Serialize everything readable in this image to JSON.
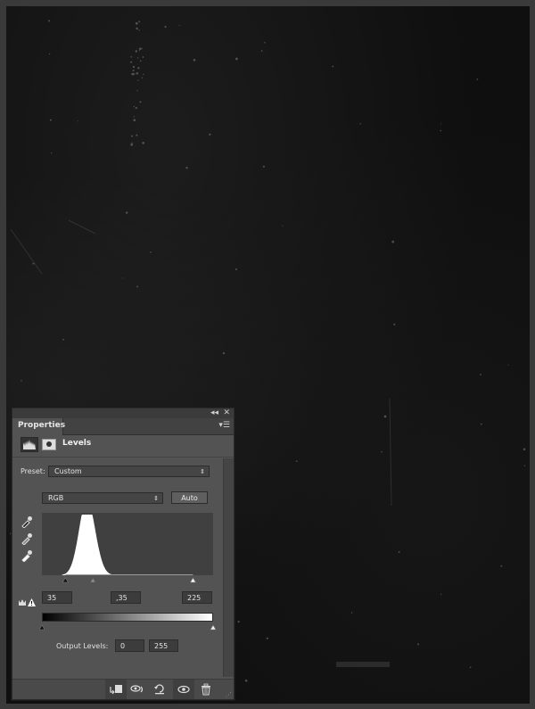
{
  "panel": {
    "tab_label": "Properties",
    "collapse_icon": "double-chevron-left-icon",
    "close_icon": "close-icon",
    "menu_icon": "panel-menu-icon",
    "adjustment_name": "Levels",
    "preset_label": "Preset:",
    "preset_value": "Custom",
    "channel_value": "RGB",
    "auto_label": "Auto",
    "input_shadows": "35",
    "input_midtones": ",35",
    "input_highlights": "225",
    "output_label": "Output Levels:",
    "output_shadows": "0",
    "output_highlights": "255"
  },
  "histogram": {
    "description": "single narrow peak of dark tones",
    "peak_start_level": 30,
    "peak_center_level": 67,
    "peak_end_level": 110,
    "input_black_point": 35,
    "input_gamma": 0.35,
    "input_white_point": 225,
    "output_black_point": 0,
    "output_white_point": 255
  },
  "footer_buttons": [
    {
      "name": "clip-to-layer-button",
      "icon": "clip-to-layer-icon"
    },
    {
      "name": "view-previous-state-button",
      "icon": "view-previous-icon"
    },
    {
      "name": "reset-button",
      "icon": "reset-icon"
    },
    {
      "name": "toggle-visibility-button",
      "icon": "eye-icon"
    },
    {
      "name": "delete-button",
      "icon": "trash-icon"
    }
  ]
}
